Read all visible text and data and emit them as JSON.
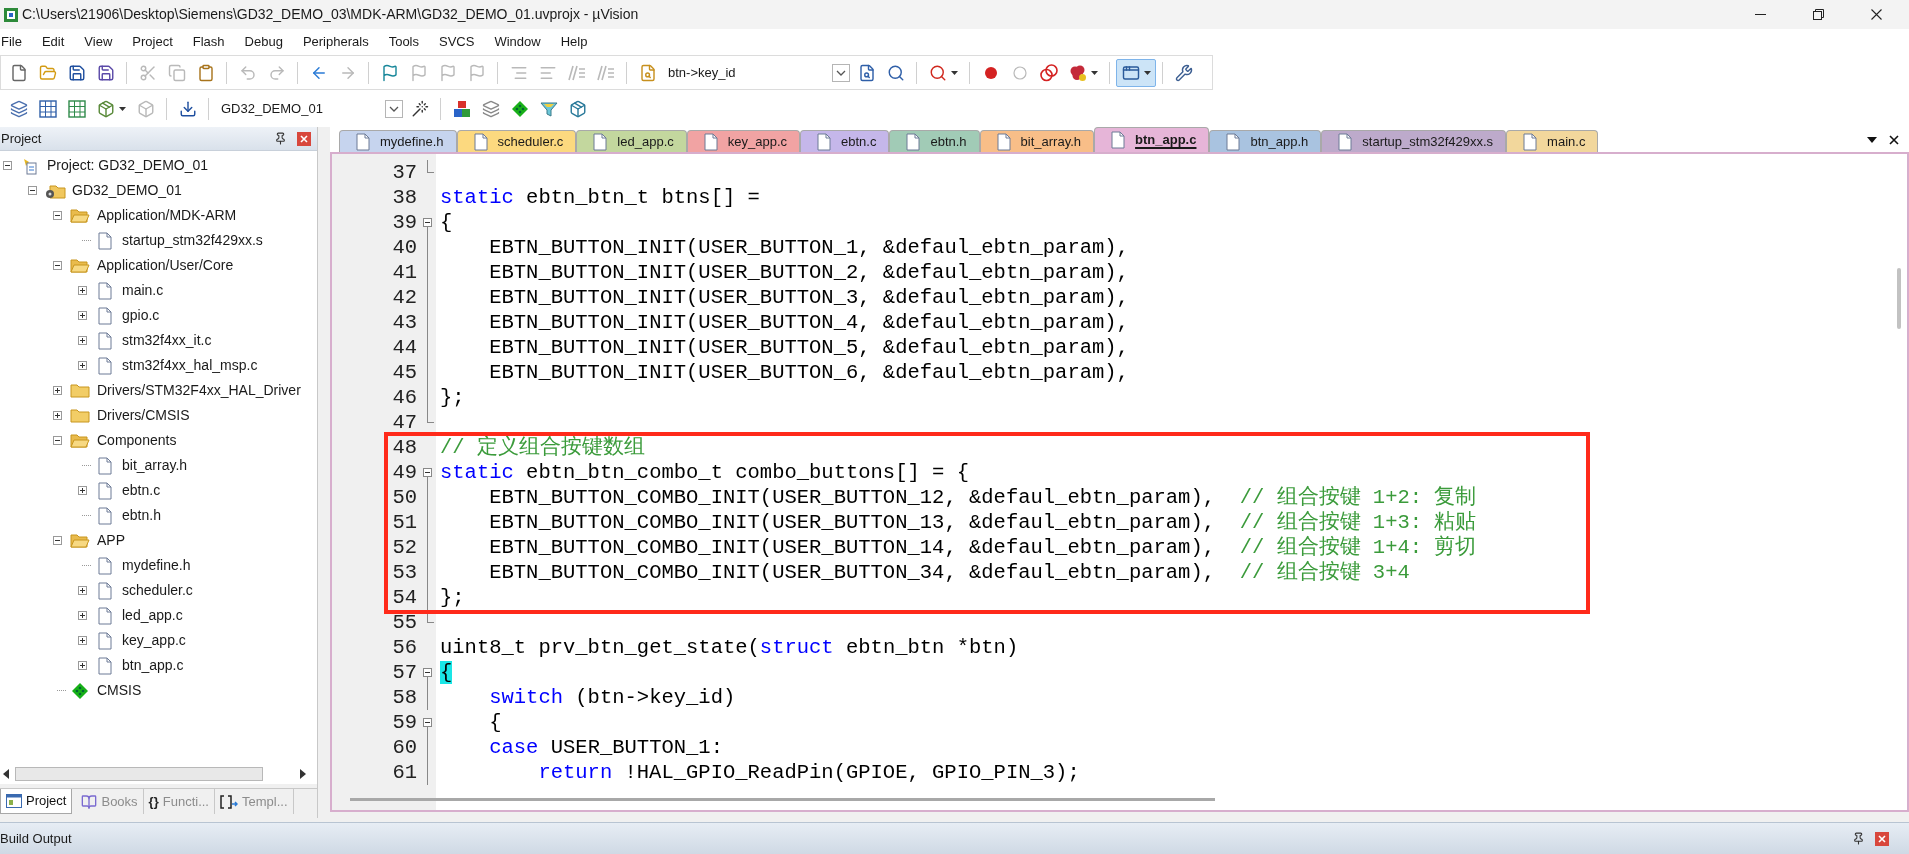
{
  "window": {
    "title": "C:\\Users\\21906\\Desktop\\Siemens\\GD32_DEMO_03\\MDK-ARM\\GD32_DEMO_01.uvprojx - µVision"
  },
  "menu": [
    "File",
    "Edit",
    "View",
    "Project",
    "Flash",
    "Debug",
    "Peripherals",
    "Tools",
    "SVCS",
    "Window",
    "Help"
  ],
  "toolbars": [
    {
      "items": [
        {
          "kind": "button",
          "disabled": false,
          "pressed": false
        },
        {
          "kind": "button",
          "disabled": false,
          "pressed": false
        },
        {
          "kind": "button",
          "disabled": false,
          "pressed": false
        },
        {
          "kind": "button",
          "disabled": false,
          "pressed": false
        },
        {
          "kind": "separator"
        },
        {
          "kind": "button",
          "disabled": true,
          "pressed": false
        },
        {
          "kind": "button",
          "disabled": true,
          "pressed": false
        },
        {
          "kind": "button",
          "disabled": false,
          "pressed": false
        },
        {
          "kind": "separator"
        },
        {
          "kind": "button",
          "disabled": true,
          "pressed": false
        },
        {
          "kind": "button",
          "disabled": true,
          "pressed": false
        },
        {
          "kind": "separator"
        },
        {
          "kind": "button",
          "disabled": false,
          "pressed": false
        },
        {
          "kind": "button",
          "disabled": true,
          "pressed": false
        },
        {
          "kind": "separator"
        },
        {
          "kind": "button",
          "disabled": false,
          "pressed": false
        },
        {
          "kind": "button",
          "disabled": true,
          "pressed": false
        },
        {
          "kind": "button",
          "disabled": true,
          "pressed": false
        },
        {
          "kind": "button",
          "disabled": true,
          "pressed": false
        },
        {
          "kind": "separator"
        },
        {
          "kind": "button",
          "disabled": true,
          "pressed": false
        },
        {
          "kind": "button",
          "disabled": true,
          "pressed": false
        },
        {
          "kind": "button",
          "disabled": true,
          "pressed": false
        },
        {
          "kind": "button",
          "disabled": true,
          "pressed": false
        },
        {
          "kind": "separator"
        },
        {
          "kind": "button",
          "disabled": false,
          "pressed": false
        },
        {
          "kind": "combo",
          "value": "btn->key_id"
        },
        {
          "kind": "button",
          "disabled": false,
          "pressed": false
        },
        {
          "kind": "button",
          "disabled": false,
          "pressed": false
        },
        {
          "kind": "separator"
        },
        {
          "kind": "split",
          "disabled": false,
          "pressed": false
        },
        {
          "kind": "separator"
        },
        {
          "kind": "button",
          "disabled": false,
          "pressed": false
        },
        {
          "kind": "button",
          "disabled": true,
          "pressed": false
        },
        {
          "kind": "button",
          "disabled": false,
          "pressed": false
        },
        {
          "kind": "split",
          "disabled": false,
          "pressed": false
        },
        {
          "kind": "separator"
        },
        {
          "kind": "split",
          "disabled": false,
          "pressed": true
        },
        {
          "kind": "separator"
        },
        {
          "kind": "button",
          "disabled": false,
          "pressed": false
        }
      ]
    },
    {
      "items": [
        {
          "kind": "button",
          "disabled": false,
          "pressed": false
        },
        {
          "kind": "button",
          "disabled": false,
          "pressed": false
        },
        {
          "kind": "button",
          "disabled": false,
          "pressed": false
        },
        {
          "kind": "split",
          "disabled": false,
          "pressed": false
        },
        {
          "kind": "button",
          "disabled": true,
          "pressed": false
        },
        {
          "kind": "separator"
        },
        {
          "kind": "button",
          "disabled": false,
          "pressed": false
        },
        {
          "kind": "separator"
        },
        {
          "kind": "combo",
          "value": "GD32_DEMO_01"
        },
        {
          "kind": "button",
          "disabled": false,
          "pressed": false
        },
        {
          "kind": "separator"
        },
        {
          "kind": "button",
          "disabled": false,
          "pressed": false
        },
        {
          "kind": "button",
          "disabled": false,
          "pressed": false
        },
        {
          "kind": "button",
          "disabled": false,
          "pressed": false
        },
        {
          "kind": "button",
          "disabled": false,
          "pressed": false
        },
        {
          "kind": "button",
          "disabled": false,
          "pressed": false
        }
      ]
    }
  ],
  "project_panel": {
    "title": "Project",
    "tree": [
      {
        "label": "Project: GD32_DEMO_01",
        "kind": "project",
        "expanded": true,
        "children": [
          {
            "label": "GD32_DEMO_01",
            "kind": "target",
            "expanded": true,
            "children": [
              {
                "label": "Application/MDK-ARM",
                "kind": "folder",
                "expanded": true,
                "children": [
                  {
                    "label": "startup_stm32f429xx.s",
                    "kind": "file"
                  }
                ]
              },
              {
                "label": "Application/User/Core",
                "kind": "folder",
                "expanded": true,
                "children": [
                  {
                    "label": "main.c",
                    "kind": "file",
                    "expanded": false
                  },
                  {
                    "label": "gpio.c",
                    "kind": "file",
                    "expanded": false
                  },
                  {
                    "label": "stm32f4xx_it.c",
                    "kind": "file",
                    "expanded": false
                  },
                  {
                    "label": "stm32f4xx_hal_msp.c",
                    "kind": "file",
                    "expanded": false
                  }
                ]
              },
              {
                "label": "Drivers/STM32F4xx_HAL_Driver",
                "kind": "folder",
                "expanded": false
              },
              {
                "label": "Drivers/CMSIS",
                "kind": "folder",
                "expanded": false
              },
              {
                "label": "Components",
                "kind": "folder",
                "expanded": true,
                "children": [
                  {
                    "label": "bit_array.h",
                    "kind": "file"
                  },
                  {
                    "label": "ebtn.c",
                    "kind": "file",
                    "expanded": false
                  },
                  {
                    "label": "ebtn.h",
                    "kind": "file"
                  }
                ]
              },
              {
                "label": "APP",
                "kind": "folder",
                "expanded": true,
                "children": [
                  {
                    "label": "mydefine.h",
                    "kind": "file"
                  },
                  {
                    "label": "scheduler.c",
                    "kind": "file",
                    "expanded": false
                  },
                  {
                    "label": "led_app.c",
                    "kind": "file",
                    "expanded": false
                  },
                  {
                    "label": "key_app.c",
                    "kind": "file",
                    "expanded": false
                  },
                  {
                    "label": "btn_app.c",
                    "kind": "file",
                    "expanded": false
                  }
                ]
              },
              {
                "label": "CMSIS",
                "kind": "component"
              }
            ]
          }
        ]
      }
    ],
    "tabs": [
      {
        "label": "Project",
        "selected": true
      },
      {
        "label": "Books",
        "selected": false
      },
      {
        "label": "Functi...",
        "glyph": "{}",
        "selected": false
      },
      {
        "label": "Templ...",
        "selected": false
      }
    ]
  },
  "editor": {
    "tabs": [
      {
        "label": "mydefine.h",
        "color": "#c6d4ee",
        "selected": false
      },
      {
        "label": "scheduler.c",
        "color": "#fcd97f",
        "selected": false
      },
      {
        "label": "led_app.c",
        "color": "#c3d79e",
        "selected": false
      },
      {
        "label": "key_app.c",
        "color": "#f1a3a3",
        "selected": false
      },
      {
        "label": "ebtn.c",
        "color": "#c5b7ea",
        "selected": false
      },
      {
        "label": "ebtn.h",
        "color": "#a1cbb6",
        "selected": false
      },
      {
        "label": "bit_array.h",
        "color": "#f8be88",
        "selected": false
      },
      {
        "label": "btn_app.c",
        "color": "#e6b5d8",
        "selected": true
      },
      {
        "label": "btn_app.h",
        "color": "#a9c3e0",
        "selected": false
      },
      {
        "label": "startup_stm32f429xx.s",
        "color": "#bdaacb",
        "selected": false
      },
      {
        "label": "main.c",
        "color": "#f2d79c",
        "selected": false
      }
    ],
    "blocks": [
      {
        "kind": "code",
        "lines": [
          {
            "number": "37",
            "kind": "closer"
          },
          {
            "number": "38",
            "kind": "plain",
            "segments": [
              {
                "kind": "keyword",
                "text": "static"
              },
              {
                "kind": "plain",
                "text": " ebtn_btn_t btns[] ="
              }
            ]
          },
          {
            "number": "39",
            "kind": "opener",
            "segments": [
              {
                "kind": "plain",
                "text": "{"
              }
            ],
            "children": [
              {
                "number": "40",
                "kind": "inside",
                "segments": [
                  {
                    "kind": "plain",
                    "text": "EBTN_BUTTON_INIT(USER_BUTTON_1, &defaul_ebtn_param),"
                  }
                ]
              },
              {
                "number": "41",
                "kind": "inside",
                "segments": [
                  {
                    "kind": "plain",
                    "text": "EBTN_BUTTON_INIT(USER_BUTTON_2, &defaul_ebtn_param),"
                  }
                ]
              },
              {
                "number": "42",
                "kind": "inside",
                "segments": [
                  {
                    "kind": "plain",
                    "text": "EBTN_BUTTON_INIT(USER_BUTTON_3, &defaul_ebtn_param),"
                  }
                ]
              },
              {
                "number": "43",
                "kind": "inside",
                "segments": [
                  {
                    "kind": "plain",
                    "text": "EBTN_BUTTON_INIT(USER_BUTTON_4, &defaul_ebtn_param),"
                  }
                ]
              },
              {
                "number": "44",
                "kind": "inside",
                "segments": [
                  {
                    "kind": "plain",
                    "text": "EBTN_BUTTON_INIT(USER_BUTTON_5, &defaul_ebtn_param),"
                  }
                ]
              },
              {
                "number": "45",
                "kind": "inside",
                "segments": [
                  {
                    "kind": "plain",
                    "text": "EBTN_BUTTON_INIT(USER_BUTTON_6, &defaul_ebtn_param),"
                  }
                ]
              }
            ]
          },
          {
            "number": "46",
            "kind": "inside",
            "segments": [
              {
                "kind": "plain",
                "text": "};"
              }
            ]
          },
          {
            "number": "47",
            "kind": "closer"
          }
        ]
      },
      {
        "kind": "framed",
        "lines": [
          {
            "number": "48",
            "kind": "plain",
            "segments": [
              {
                "kind": "comment",
                "text": "// 定义组合按键数组"
              }
            ]
          },
          {
            "number": "49",
            "kind": "opener",
            "segments": [
              {
                "kind": "keyword",
                "text": "static"
              },
              {
                "kind": "plain",
                "text": " ebtn_btn_combo_t combo_buttons[] = {"
              }
            ],
            "children": [
              {
                "number": "50",
                "kind": "inside",
                "segments": [
                  {
                    "kind": "plain",
                    "text": "EBTN_BUTTON_COMBO_INIT(USER_BUTTON_12, &defaul_ebtn_param),  "
                  },
                  {
                    "kind": "comment",
                    "text": "// 组合按键 1+2: 复制"
                  }
                ]
              },
              {
                "number": "51",
                "kind": "inside",
                "segments": [
                  {
                    "kind": "plain",
                    "text": "EBTN_BUTTON_COMBO_INIT(USER_BUTTON_13, &defaul_ebtn_param),  "
                  },
                  {
                    "kind": "comment",
                    "text": "// 组合按键 1+3: 粘贴"
                  }
                ]
              },
              {
                "number": "52",
                "kind": "inside",
                "segments": [
                  {
                    "kind": "plain",
                    "text": "EBTN_BUTTON_COMBO_INIT(USER_BUTTON_14, &defaul_ebtn_param),  "
                  },
                  {
                    "kind": "comment",
                    "text": "// 组合按键 1+4: 剪切"
                  }
                ]
              },
              {
                "number": "53",
                "kind": "inside",
                "segments": [
                  {
                    "kind": "plain",
                    "text": "EBTN_BUTTON_COMBO_INIT(USER_BUTTON_34, &defaul_ebtn_param),  "
                  },
                  {
                    "kind": "comment",
                    "text": "// 组合按键 3+4"
                  }
                ]
              }
            ]
          },
          {
            "number": "54",
            "kind": "inside",
            "segments": [
              {
                "kind": "plain",
                "text": "};"
              }
            ]
          }
        ]
      },
      {
        "kind": "code",
        "lines": [
          {
            "number": "55",
            "kind": "closer"
          },
          {
            "number": "56",
            "kind": "plain",
            "segments": [
              {
                "kind": "plain",
                "text": "uint8_t prv_btn_get_state("
              },
              {
                "kind": "keyword",
                "text": "struct"
              },
              {
                "kind": "plain",
                "text": " ebtn_btn *btn)"
              }
            ]
          },
          {
            "number": "57",
            "kind": "opener",
            "segments": [
              {
                "kind": "brace",
                "text": "{"
              }
            ],
            "children": [
              {
                "number": "58",
                "kind": "inside",
                "segments": [
                  {
                    "kind": "keyword",
                    "text": "switch"
                  },
                  {
                    "kind": "plain",
                    "text": " (btn->key_id)"
                  }
                ]
              },
              {
                "number": "59",
                "kind": "opener",
                "segments": [
                  {
                    "kind": "plain",
                    "text": "{"
                  }
                ]
              },
              {
                "number": "60",
                "kind": "inside",
                "segments": [
                  {
                    "kind": "keyword",
                    "text": "case"
                  },
                  {
                    "kind": "plain",
                    "text": " USER_BUTTON_1:"
                  }
                ],
                "children": [
                  {
                    "number": "61",
                    "kind": "inside",
                    "segments": [
                      {
                        "kind": "keyword",
                        "text": "return"
                      },
                      {
                        "kind": "plain",
                        "text": " !HAL_GPIO_ReadPin(GPIOE, GPIO_PIN_3);"
                      }
                    ]
                  }
                ]
              }
            ]
          }
        ]
      }
    ]
  },
  "build_output": {
    "title": "Build Output"
  }
}
